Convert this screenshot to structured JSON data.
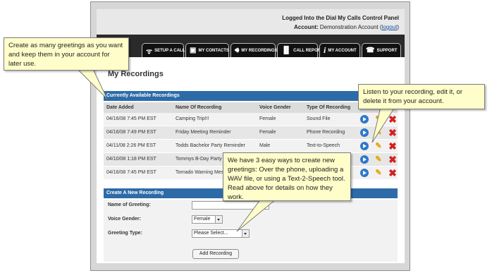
{
  "header": {
    "logged_in": "Logged Into the Dial My Calls Control Panel",
    "account_label": "Account:",
    "account_name": "Demonstration Account",
    "logout_prefix": "(",
    "logout": "logout",
    "logout_suffix": ")"
  },
  "tabs": [
    {
      "label": "SETUP A CALL",
      "icon": "signal-icon"
    },
    {
      "label": "MY CONTACTS",
      "icon": "contacts-icon"
    },
    {
      "label": "MY RECORDINGS",
      "icon": "speaker-icon"
    },
    {
      "label": "CALL REPORTS",
      "icon": "bar-chart-icon"
    },
    {
      "label": "MY ACCOUNT",
      "icon": "info-icon"
    },
    {
      "label": "SUPPORT",
      "icon": "phone-icon"
    }
  ],
  "page_title": "My Recordings",
  "recordings": {
    "heading": "Currently Available Recordings",
    "columns": [
      "Date Added",
      "Name Of Recording",
      "Voice Gender",
      "Type Of Recording"
    ],
    "rows": [
      {
        "date": "04/16/08 7:45 PM EST",
        "name": "Camping Trip!!!",
        "gender": "Female",
        "type": "Sound File"
      },
      {
        "date": "04/16/08 7:49 PM EST",
        "name": "Friday Meeting Reminder",
        "gender": "Female",
        "type": "Phone Recording"
      },
      {
        "date": "04/11/08 2:26 PM EST",
        "name": "Todds Bachelor Party Reminder",
        "gender": "Male",
        "type": "Text-to-Speech"
      },
      {
        "date": "04/10/08 1:18 PM EST",
        "name": "Tommys B-Day Party",
        "gender": "",
        "type": ""
      },
      {
        "date": "04/16/08 7:45 PM EST",
        "name": "Tornado Warning Mess",
        "gender": "",
        "type": ""
      }
    ]
  },
  "create": {
    "heading": "Create A New Recording",
    "name_label": "Name of Greeting:",
    "name_value": "",
    "gender_label": "Voice Gender:",
    "gender_value": "Female",
    "type_label": "Greeting Type:",
    "type_value": "Please Select...",
    "button": "Add Recording"
  },
  "callouts": {
    "greetings": "Create as many greetings as you want and keep them in your account for later use.",
    "listen": "Listen to your recording, edit it, or delete it from your account.",
    "ways": "We have 3 easy ways to create new greetings:  Over the phone, uploading a WAV file, or using a Text-2-Speech tool.  Read above for details on how they work."
  },
  "colors": {
    "panel_header": "#2d6ba8",
    "tab_bar": "#111111",
    "callout_bg": "#fffeca",
    "play": "#2f78c8",
    "edit": "#e8a000",
    "delete": "#d42020"
  }
}
